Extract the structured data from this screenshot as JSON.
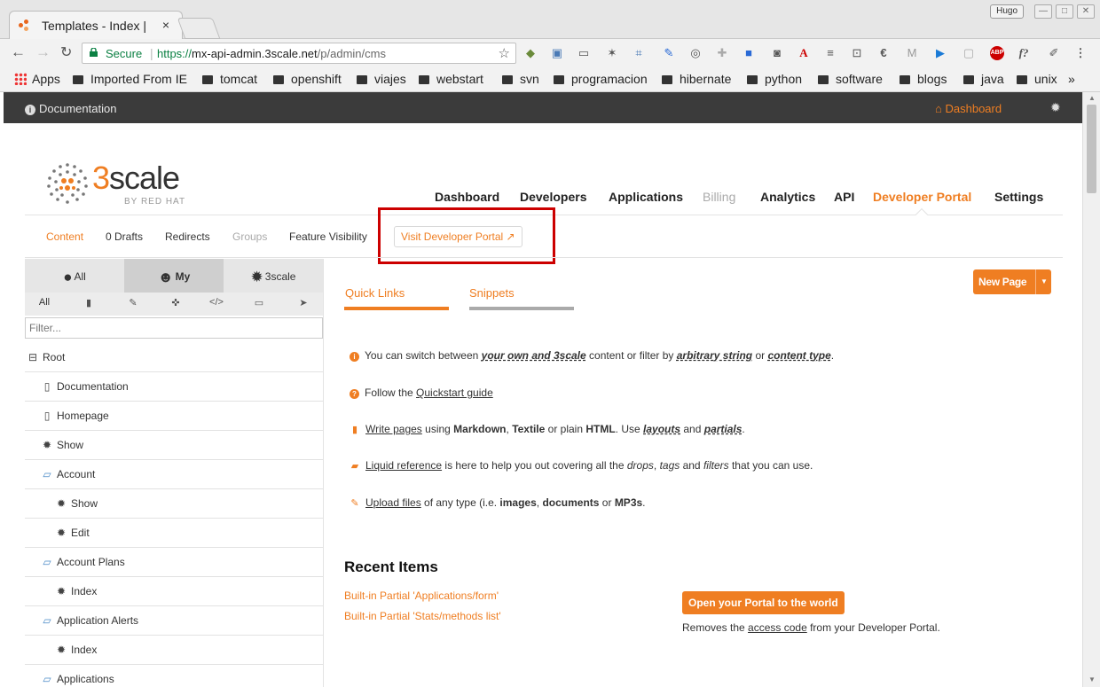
{
  "browser": {
    "tab_title": "Templates - Index |",
    "tab_close": "×",
    "profile": "Hugo",
    "secure_label": "Secure",
    "url_scheme": "https://",
    "url_host": "mx-api-admin.3scale.net",
    "url_path": "/p/admin/cms",
    "bookmarks": [
      "Apps",
      "Imported From IE",
      "tomcat",
      "openshift",
      "viajes",
      "webstart",
      "svn",
      "programacion",
      "hibernate",
      "python",
      "software",
      "blogs",
      "java",
      "unix"
    ],
    "bookmarks_more": "»"
  },
  "topbar": {
    "documentation": "Documentation",
    "dashboard": "Dashboard"
  },
  "logo": {
    "digit": "3",
    "word": "scale",
    "by": "BY RED HAT"
  },
  "main_nav": [
    "Dashboard",
    "Developers",
    "Applications",
    "Billing",
    "Analytics",
    "API",
    "Developer Portal",
    "Settings"
  ],
  "sub_nav": {
    "content": "Content",
    "drafts": "0 Drafts",
    "redirects": "Redirects",
    "groups": "Groups",
    "feature_visibility": "Feature Visibility",
    "visit_portal": "Visit Developer Portal"
  },
  "sidebar": {
    "tabs": [
      "All",
      "My",
      "3scale"
    ],
    "filter_all": "All",
    "filter_placeholder": "Filter...",
    "tree": [
      "Root",
      "Documentation",
      "Homepage",
      "Show",
      "Account",
      "Show",
      "Edit",
      "Account Plans",
      "Index",
      "Application Alerts",
      "Index",
      "Applications"
    ]
  },
  "content": {
    "tab_quick_links": "Quick Links",
    "tab_snippets": "Snippets",
    "new_page": "New Page",
    "quick_links": {
      "l1_a": "You can switch between ",
      "l1_b": "your own and 3scale",
      "l1_c": " content or filter by ",
      "l1_d": "arbitrary string",
      "l1_e": " or ",
      "l1_f": "content type",
      "l1_g": ".",
      "l2_a": "Follow the ",
      "l2_b": "Quickstart guide",
      "l3_a": "Write pages",
      "l3_b": " using ",
      "l3_c": "Markdown",
      "l3_d": ", ",
      "l3_e": "Textile",
      "l3_f": " or plain ",
      "l3_g": "HTML",
      "l3_h": ". Use ",
      "l3_i": "layouts",
      "l3_j": " and ",
      "l3_k": "partials",
      "l3_l": ".",
      "l4_a": "Liquid reference",
      "l4_b": " is here to help you out covering all the ",
      "l4_c": "drops",
      "l4_d": ", ",
      "l4_e": "tags",
      "l4_f": " and ",
      "l4_g": "filters",
      "l4_h": " that you can use.",
      "l5_a": "Upload files",
      "l5_b": " of any type (i.e. ",
      "l5_c": "images",
      "l5_d": ", ",
      "l5_e": "documents",
      "l5_f": " or ",
      "l5_g": "MP3s",
      "l5_h": "."
    },
    "recent_title": "Recent Items",
    "recent_items": [
      "Built-in Partial 'Applications/form'",
      "Built-in Partial 'Stats/methods list'"
    ],
    "open_portal": "Open your Portal to the world",
    "removes_a": "Removes the ",
    "removes_b": "access code",
    "removes_c": " from your Developer Portal."
  },
  "colors": {
    "accent": "#ef7e22",
    "topbar": "#3b3b3b",
    "highlight": "#cc0000"
  }
}
